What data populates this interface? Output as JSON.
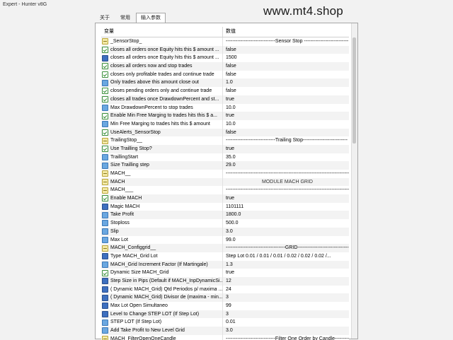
{
  "window": {
    "title": "Expert - Hunter v8G"
  },
  "watermark": "www.mt4.shop",
  "tabs": [
    {
      "label": "关于",
      "active": false
    },
    {
      "label": "常用",
      "active": false
    },
    {
      "label": "输入参数",
      "active": true
    }
  ],
  "table": {
    "col_variable": "变量",
    "col_value": "数值",
    "rows": [
      {
        "icon": "str",
        "name": "_SensorStop_",
        "value": "------------------------------Sensor Stop ---------------------------"
      },
      {
        "icon": "bool",
        "name": "closes all orders once Equity hits this $ amount ...",
        "value": "false"
      },
      {
        "icon": "num",
        "name": "closes all orders once Equity hits this $ amount ...",
        "value": "1500"
      },
      {
        "icon": "bool",
        "name": "closes all orders now and stop trades",
        "value": "false"
      },
      {
        "icon": "bool",
        "name": "closes only profitable trades and continue trade",
        "value": "false"
      },
      {
        "icon": "dbl",
        "name": "Only trades above this amount close out",
        "value": "1.0"
      },
      {
        "icon": "bool",
        "name": "closes pending orders only and continue trade",
        "value": "false"
      },
      {
        "icon": "bool",
        "name": "closes all trades once  DrawdownPercent and st...",
        "value": "true"
      },
      {
        "icon": "dbl",
        "name": "Max  DrawdownPercent to stop trades",
        "value": "10.0"
      },
      {
        "icon": "bool",
        "name": "Enable Min  Free Marging to trades hits this $ a...",
        "value": "true"
      },
      {
        "icon": "dbl",
        "name": "Min  Free Marging to trades hits this $ amount",
        "value": "10.0"
      },
      {
        "icon": "bool",
        "name": "UseAlerts_SensorStop",
        "value": "false"
      },
      {
        "icon": "str",
        "name": "TrailingStop__",
        "value": "------------------------------Trailing Stop---------------------------"
      },
      {
        "icon": "bool",
        "name": "Use Trailling Stop?",
        "value": "true"
      },
      {
        "icon": "dbl",
        "name": "TraillingStart",
        "value": "35.0"
      },
      {
        "icon": "dbl",
        "name": "Size Trailling step",
        "value": "29.0"
      },
      {
        "icon": "str",
        "name": "MACH__",
        "value": "------------------------------------------------------------------------------"
      },
      {
        "icon": "str",
        "name": "MACH",
        "value": "MODULE MACH GRID",
        "center": true
      },
      {
        "icon": "str",
        "name": "MACH___",
        "value": "------------------------------------------------------------------------------"
      },
      {
        "icon": "bool",
        "name": "Enable MACH",
        "value": "true"
      },
      {
        "icon": "num",
        "name": "Magic MACH",
        "value": "1101111"
      },
      {
        "icon": "dbl",
        "name": "Take Profit",
        "value": "1800.0"
      },
      {
        "icon": "dbl",
        "name": "Stoploss",
        "value": "500.0"
      },
      {
        "icon": "dbl",
        "name": "Slip",
        "value": "3.0"
      },
      {
        "icon": "dbl",
        "name": "Max Lot",
        "value": "99.0"
      },
      {
        "icon": "str",
        "name": "MACH_Configgrid__",
        "value": "------------------------------------GRID-------------------------------"
      },
      {
        "icon": "num",
        "name": "Type MACH_Grid Lot",
        "value": "Step Lot     0.01 / 0.01 / 0.01 / 0.02 / 0.02 / 0.02 /..."
      },
      {
        "icon": "dbl",
        "name": "MACH_Grid Increment Factor (If Martingale)",
        "value": "1.3"
      },
      {
        "icon": "bool",
        "name": "Dynamic Size MACH_Grid",
        "value": "true"
      },
      {
        "icon": "num",
        "name": "Step Size in Pips (Default if MACH_InpDynamicSi...",
        "value": "12"
      },
      {
        "icon": "num",
        "name": "( Dynamic MACH_Grid) Qtd Periodos p/ maxima ...",
        "value": "24"
      },
      {
        "icon": "num",
        "name": "( Dynamic MACH_Grid) Divisor de (maxima - min...",
        "value": "3"
      },
      {
        "icon": "num",
        "name": "Max Lot Open Simultaneo",
        "value": "99"
      },
      {
        "icon": "num",
        "name": "Level to Change STEP LOT (If  Step Lot)",
        "value": "3"
      },
      {
        "icon": "dbl",
        "name": "STEP LOT (If  Step Lot)",
        "value": "0.01"
      },
      {
        "icon": "dbl",
        "name": "Add Take Profit to New Level Grid",
        "value": "3.0"
      },
      {
        "icon": "str",
        "name": "MACH_FilterOpenOneCandle",
        "value": "------------------------------Filter One Order by Candle----------"
      }
    ]
  }
}
